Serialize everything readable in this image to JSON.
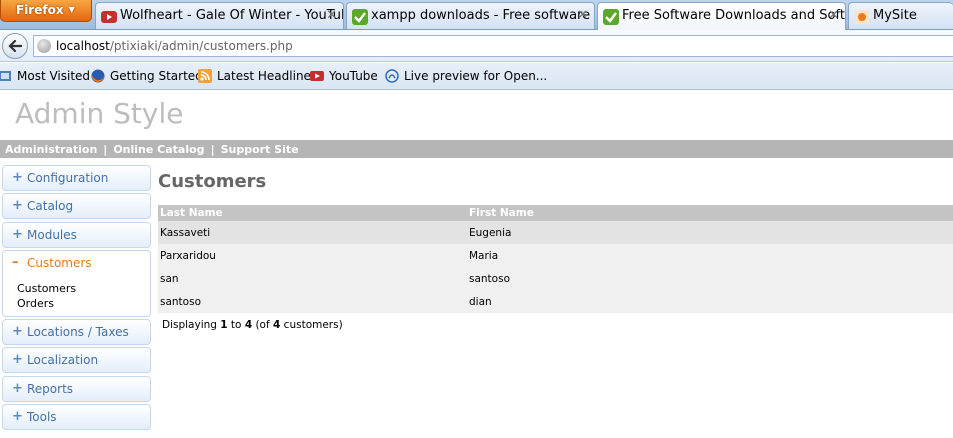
{
  "browser": {
    "app_button": "Firefox",
    "tabs": [
      {
        "title": "Wolfheart - Gale Of Winter - YouTube",
        "icon": "youtube-icon"
      },
      {
        "title": "xampp downloads - Free software do...",
        "icon": "download-check-icon"
      },
      {
        "title": "Free Software Downloads and Softwa...",
        "icon": "download-check-icon"
      },
      {
        "title": "MySite",
        "icon": "site-icon"
      }
    ],
    "url": {
      "host": "localhost",
      "path": "/ptixiaki/admin/customers.php"
    },
    "bookmarks": [
      {
        "label": "Most Visited",
        "icon": "most-visited-icon"
      },
      {
        "label": "Getting Started",
        "icon": "firefox-icon"
      },
      {
        "label": "Latest Headlines",
        "icon": "rss-icon"
      },
      {
        "label": "YouTube",
        "icon": "youtube-icon"
      },
      {
        "label": "Live preview for Open...",
        "icon": "preview-icon"
      }
    ]
  },
  "page": {
    "heading": "Admin Style",
    "top_links": [
      "Administration",
      "Online Catalog",
      "Support Site"
    ],
    "separator": "|"
  },
  "sidebar": {
    "items": [
      {
        "label": "Configuration",
        "marker": "+"
      },
      {
        "label": "Catalog",
        "marker": "+"
      },
      {
        "label": "Modules",
        "marker": "+"
      },
      {
        "label": "Customers",
        "marker": "–",
        "sub": [
          "Customers",
          "Orders"
        ]
      },
      {
        "label": "Locations / Taxes",
        "marker": "+"
      },
      {
        "label": "Localization",
        "marker": "+"
      },
      {
        "label": "Reports",
        "marker": "+"
      },
      {
        "label": "Tools",
        "marker": "+"
      }
    ]
  },
  "main": {
    "title": "Customers",
    "columns": [
      "Last Name",
      "First Name"
    ],
    "rows": [
      [
        "Kassaveti",
        "Eugenia"
      ],
      [
        "Parxaridou",
        "Maria"
      ],
      [
        "san",
        "santoso"
      ],
      [
        "santoso",
        "dian"
      ]
    ],
    "footer": {
      "prefix": "Displaying ",
      "from": "1",
      "to_word": " to ",
      "to": "4",
      "of_open": " (of ",
      "total": "4",
      "suffix": " customers)"
    }
  },
  "colors": {
    "accent_orange": "#e07b18",
    "link_blue": "#4470a8",
    "header_gray": "#b5b5b5"
  }
}
